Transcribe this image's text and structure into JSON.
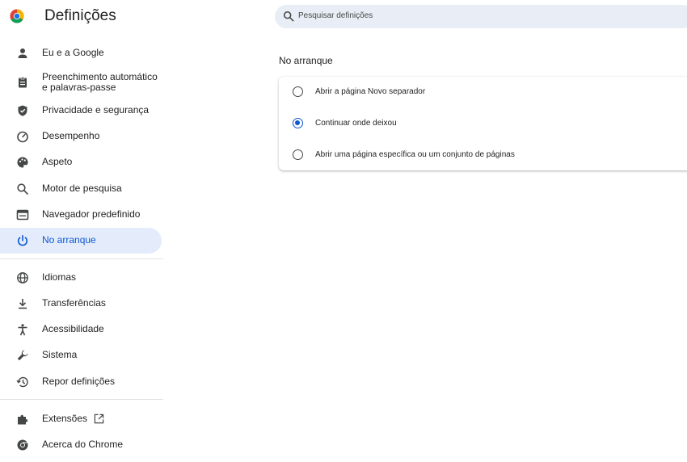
{
  "header": {
    "title": "Definições"
  },
  "search": {
    "placeholder": "Pesquisar definições"
  },
  "sidebar": {
    "items": [
      {
        "label": "Eu e a Google",
        "icon": "person-icon"
      },
      {
        "label": "Preenchimento automático e palavras-passe",
        "icon": "clipboard-icon"
      },
      {
        "label": "Privacidade e segurança",
        "icon": "shield-icon"
      },
      {
        "label": "Desempenho",
        "icon": "speedometer-icon"
      },
      {
        "label": "Aspeto",
        "icon": "palette-icon"
      },
      {
        "label": "Motor de pesquisa",
        "icon": "search-icon"
      },
      {
        "label": "Navegador predefinido",
        "icon": "browser-icon"
      },
      {
        "label": "No arranque",
        "icon": "power-icon",
        "active": true
      },
      {
        "label": "Idiomas",
        "icon": "globe-icon"
      },
      {
        "label": "Transferências",
        "icon": "download-icon"
      },
      {
        "label": "Acessibilidade",
        "icon": "accessibility-icon"
      },
      {
        "label": "Sistema",
        "icon": "wrench-icon"
      },
      {
        "label": "Repor definições",
        "icon": "history-icon"
      },
      {
        "label": "Extensões",
        "icon": "puzzle-icon"
      },
      {
        "label": "Acerca do Chrome",
        "icon": "chrome-icon"
      }
    ]
  },
  "main": {
    "section_title": "No arranque",
    "options": [
      {
        "label": "Abrir a página Novo separador",
        "checked": false
      },
      {
        "label": "Continuar onde deixou",
        "checked": true
      },
      {
        "label": "Abrir uma página específica ou um conjunto de páginas",
        "checked": false
      }
    ]
  },
  "colors": {
    "accent": "#0b57d0",
    "active_bg": "#e4ecfb",
    "search_bg": "#e9eef6"
  }
}
